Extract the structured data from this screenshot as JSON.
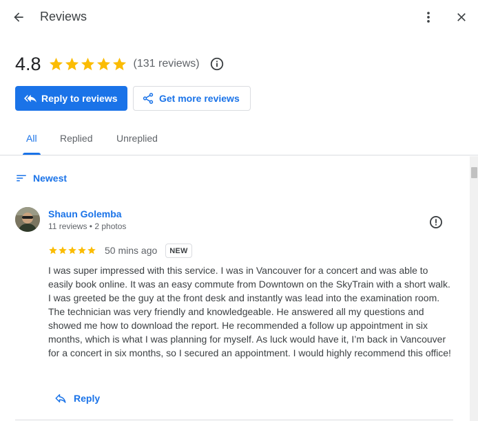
{
  "header": {
    "title": "Reviews"
  },
  "summary": {
    "rating": "4.8",
    "stars": 5,
    "review_count": "(131 reviews)"
  },
  "actions": {
    "reply_label": "Reply to reviews",
    "get_more_label": "Get more reviews"
  },
  "tabs": [
    {
      "label": "All",
      "active": true
    },
    {
      "label": "Replied",
      "active": false
    },
    {
      "label": "Unreplied",
      "active": false
    }
  ],
  "sort": {
    "label": "Newest"
  },
  "review": {
    "author": "Shaun Golemba",
    "meta": "11 reviews • 2 photos",
    "stars": 5,
    "time": "50 mins ago",
    "badge": "NEW",
    "text": "I was super impressed with this service. I was in Vancouver for a concert and was able to easily book online. It was an easy commute from Downtown on the SkyTrain with a short walk. I was greeted be the guy at the front desk and instantly was lead into the examination room. The technician was very friendly and knowledgeable. He answered all my questions and showed me how to download the report. He recommended a follow up appointment in six months, which is what I was planning for myself. As luck would have it, I’m back in Vancouver for a concert in six months, so I secured an appointment. I would highly recommend this office!",
    "reply_label": "Reply"
  },
  "colors": {
    "accent": "#1a73e8",
    "star": "#fbbc04",
    "text_secondary": "#5f6368",
    "divider": "#dadce0"
  },
  "icons": {
    "back": "arrow-left-icon",
    "more": "more-vert-icon",
    "close": "close-icon",
    "info": "info-icon",
    "reply": "reply-all-icon",
    "share": "share-icon",
    "sort": "sort-icon",
    "flag": "report-icon",
    "reply_single": "reply-icon"
  }
}
